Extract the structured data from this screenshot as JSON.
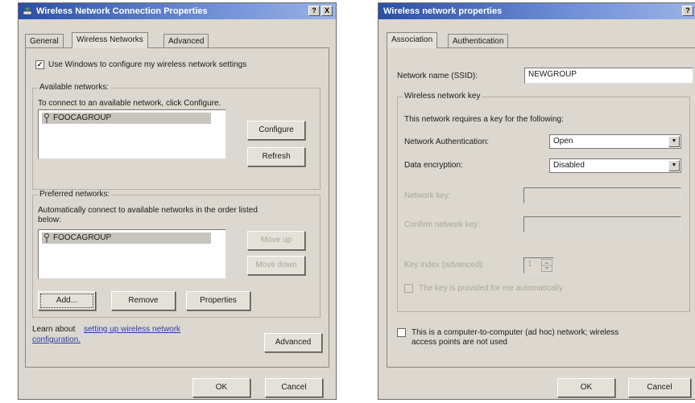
{
  "left": {
    "title": "Wireless Network Connection Properties",
    "help_btn": "?",
    "close_btn": "X",
    "tabs": [
      "General",
      "Wireless Networks",
      "Advanced"
    ],
    "use_windows_checkbox": "✓",
    "use_windows_label": "Use Windows to configure my wireless network settings",
    "available": {
      "legend": "Available networks:",
      "instruction": "To connect to an available network, click Configure.",
      "items": [
        "FOOCAGROUP"
      ],
      "configure": "Configure",
      "refresh": "Refresh"
    },
    "preferred": {
      "legend": "Preferred networks:",
      "instruction_line1": "Automatically connect to available networks in the order listed",
      "instruction_line2": "below:",
      "items": [
        "FOOCAGROUP"
      ],
      "move_up": "Move up",
      "move_down": "Move down",
      "add": "Add...",
      "remove": "Remove",
      "properties": "Properties"
    },
    "learn_about": "Learn about",
    "learn_link_line1": "setting up wireless network",
    "learn_link_line2": "configuration.",
    "advanced_btn": "Advanced",
    "ok": "OK",
    "cancel": "Cancel"
  },
  "right": {
    "title": "Wireless network properties",
    "help_btn": "?",
    "tabs": [
      "Association",
      "Authentication"
    ],
    "ssid_label": "Network name (SSID):",
    "ssid_value": "NEWGROUP",
    "key_group": "Wireless network key",
    "key_info": "This network requires a key for the following:",
    "auth_label": "Network Authentication:",
    "auth_value": "Open",
    "enc_label": "Data encryption:",
    "enc_value": "Disabled",
    "netkey_label": "Network key:",
    "confirm_label": "Confirm network key:",
    "keyindex_label": "Key index (advanced):",
    "keyindex_value": "1",
    "auto_key_label": "The key is provided for me automatically",
    "adhoc_line1": "This is a computer-to-computer (ad hoc) network; wireless",
    "adhoc_line2": "access points are not used",
    "ok": "OK",
    "cancel": "Cancel"
  },
  "colors": {
    "titlebar": "#2a4fa8",
    "dialog_bg": "#dcd8cf",
    "link": "#2a3fa6"
  }
}
